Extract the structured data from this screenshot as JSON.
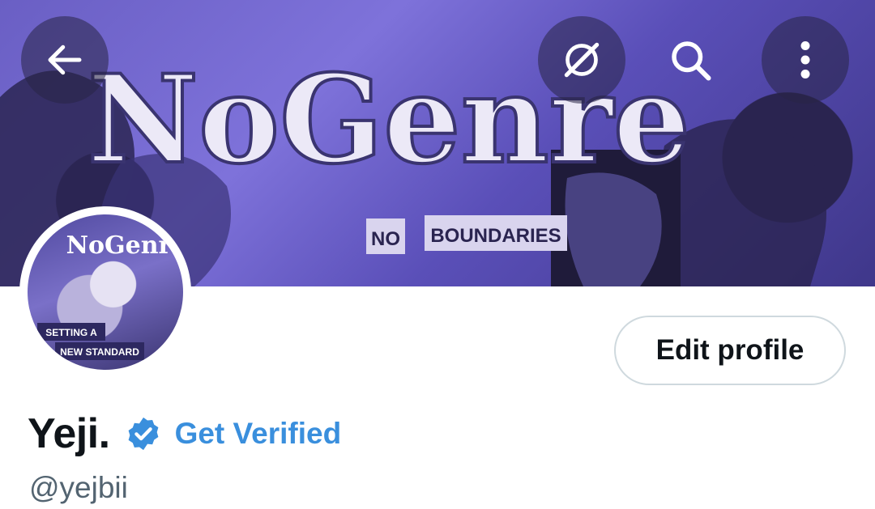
{
  "banner": {
    "logo_text": "NoGenre",
    "tagline_left": "NO",
    "tagline_right": "BOUNDARIES",
    "accent": "#7a6fd6"
  },
  "header": {
    "back_icon": "arrow-left-icon",
    "grok_icon": "grok-icon",
    "search_icon": "search-icon",
    "more_icon": "more-vertical-icon"
  },
  "avatar": {
    "logo_text": "NoGenre",
    "caption_line1": "SETTING A",
    "caption_line2": "NEW STANDARD"
  },
  "profile": {
    "display_name": "Yeji.",
    "handle": "@yejbii",
    "edit_label": "Edit profile",
    "get_verified_label": "Get Verified",
    "badge_color": "#3a8fdd"
  }
}
